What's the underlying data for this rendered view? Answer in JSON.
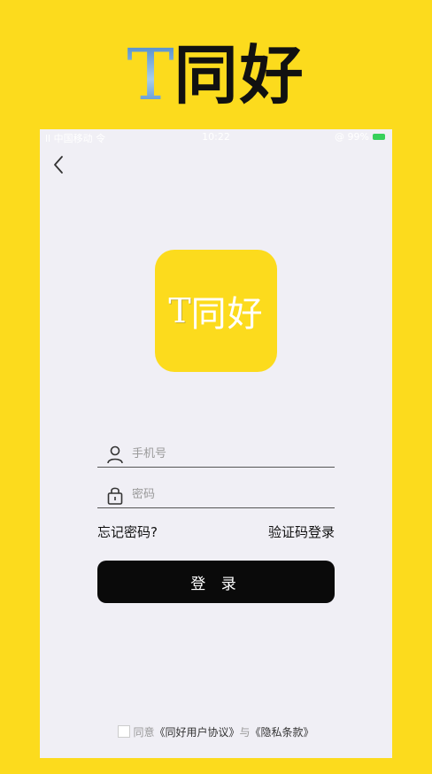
{
  "promo": {
    "title_letter": "T",
    "title_text": "同好"
  },
  "status_bar": {
    "left": "ll 中国移动 令",
    "time": "10:22",
    "right": "@ 99%"
  },
  "logo": {
    "letter": "T",
    "text": "同好"
  },
  "phone_field": {
    "placeholder": "手机号",
    "icon": "user-icon"
  },
  "password_field": {
    "placeholder": "密码",
    "icon": "lock-icon"
  },
  "links": {
    "forgot": "忘记密码?",
    "code_login": "验证码登录"
  },
  "login_button": {
    "label": "登 录"
  },
  "agreement": {
    "prefix": "同意",
    "user_agreement": "《同好用户协议》",
    "conjunction": "与",
    "privacy": "《隐私条款》"
  },
  "colors": {
    "accent": "#FCDB1D",
    "button": "#0A0A0A",
    "background": "#F0EFF5"
  }
}
